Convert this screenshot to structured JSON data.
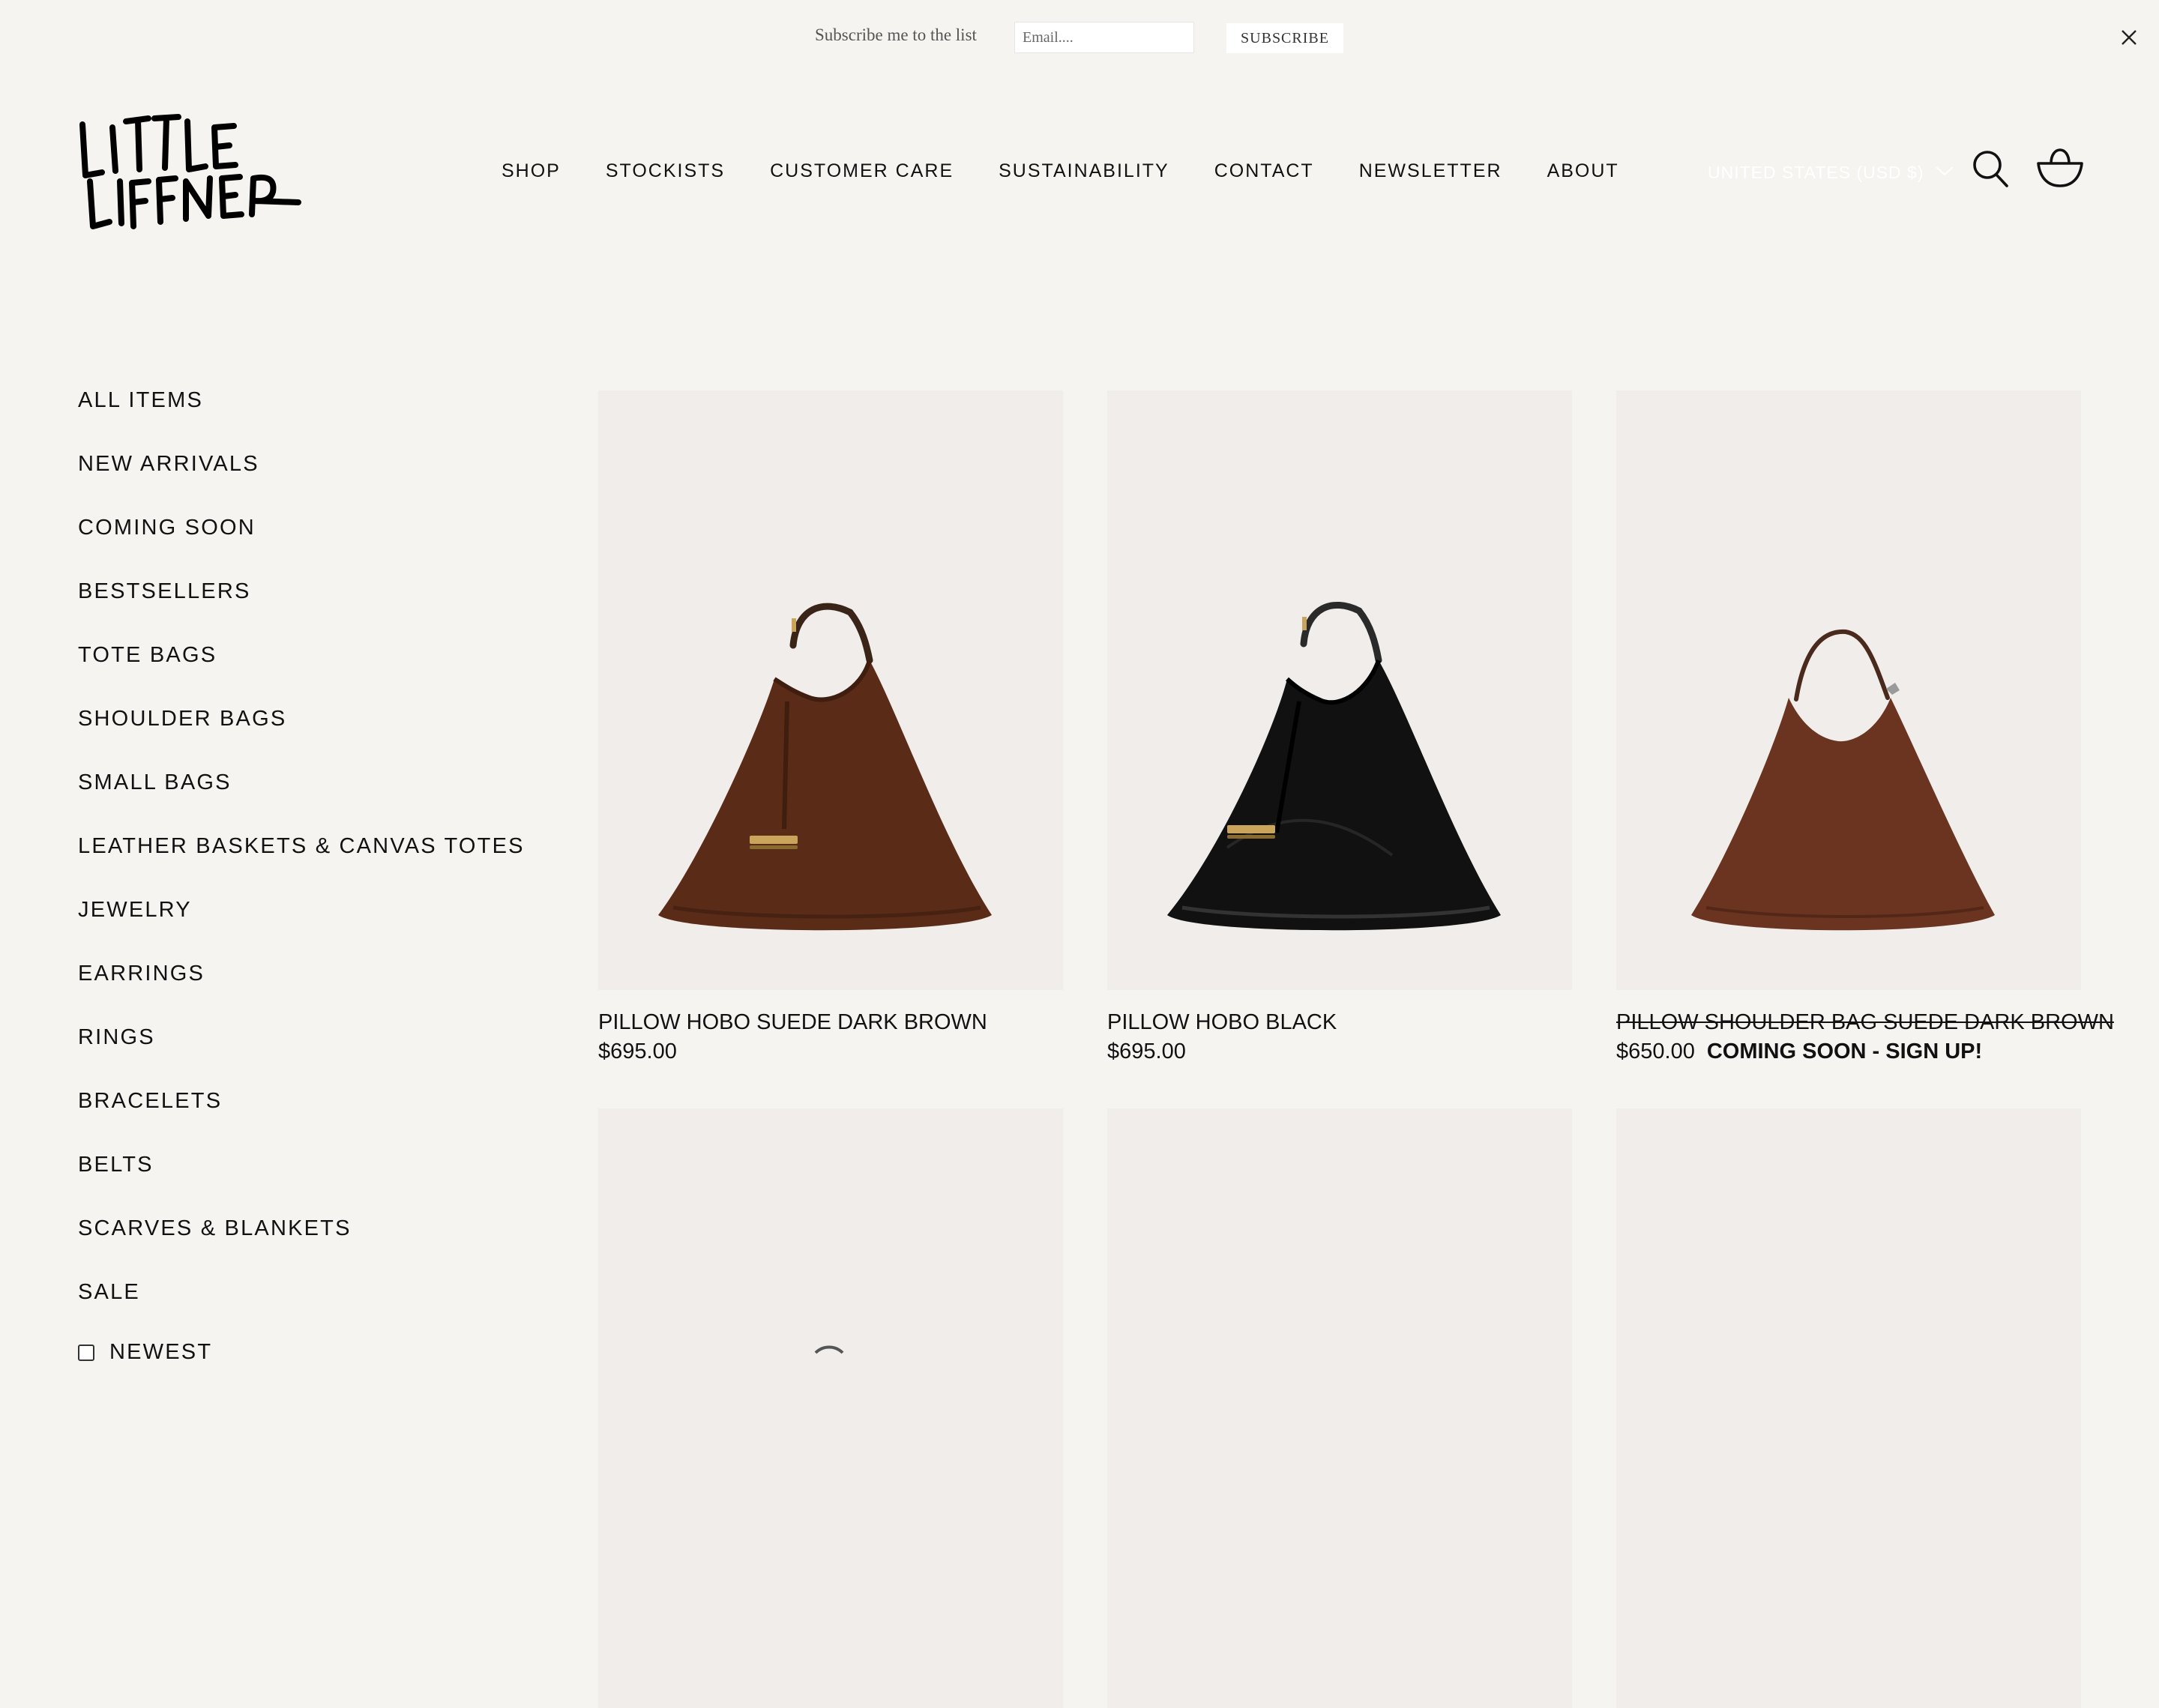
{
  "subscribe_bar": {
    "label": "Subscribe me to the list",
    "email_placeholder": "Email....",
    "button_label": "SUBSCRIBE",
    "close_icon": "close-icon"
  },
  "header": {
    "logo_text": "LITTLE LIFFNER",
    "nav": [
      {
        "label": "SHOP"
      },
      {
        "label": "STOCKISTS"
      },
      {
        "label": "CUSTOMER CARE"
      },
      {
        "label": "SUSTAINABILITY"
      },
      {
        "label": "CONTACT"
      },
      {
        "label": "NEWSLETTER"
      },
      {
        "label": "ABOUT"
      }
    ],
    "currency": "UNITED STATES (USD $)",
    "search_icon": "search-icon",
    "cart_icon": "basket-icon"
  },
  "sidebar": {
    "items": [
      {
        "label": "ALL ITEMS"
      },
      {
        "label": "NEW ARRIVALS"
      },
      {
        "label": "COMING SOON"
      },
      {
        "label": "BESTSELLERS"
      },
      {
        "label": "TOTE BAGS"
      },
      {
        "label": "SHOULDER BAGS"
      },
      {
        "label": "SMALL BAGS"
      },
      {
        "label": "LEATHER BASKETS & CANVAS TOTES"
      },
      {
        "label": "JEWELRY"
      },
      {
        "label": "EARRINGS"
      },
      {
        "label": "RINGS"
      },
      {
        "label": "BRACELETS"
      },
      {
        "label": "BELTS"
      },
      {
        "label": "SCARVES & BLANKETS"
      },
      {
        "label": "SALE"
      }
    ],
    "sort_option": "NEWEST"
  },
  "products": [
    {
      "name": "PILLOW HOBO SUEDE DARK BROWN",
      "price": "$695.00",
      "badge": "",
      "color": "#5a2c18",
      "strap_color": "#3a2418"
    },
    {
      "name": "PILLOW HOBO BLACK",
      "price": "$695.00",
      "badge": "",
      "color": "#111111",
      "strap_color": "#2a2a2a"
    },
    {
      "name": "PILLOW SHOULDER BAG SUEDE DARK BROWN",
      "price": "$650.00",
      "badge": "COMING SOON - SIGN UP!",
      "color": "#6a3420",
      "strap_color": "#4a2a1c"
    }
  ]
}
